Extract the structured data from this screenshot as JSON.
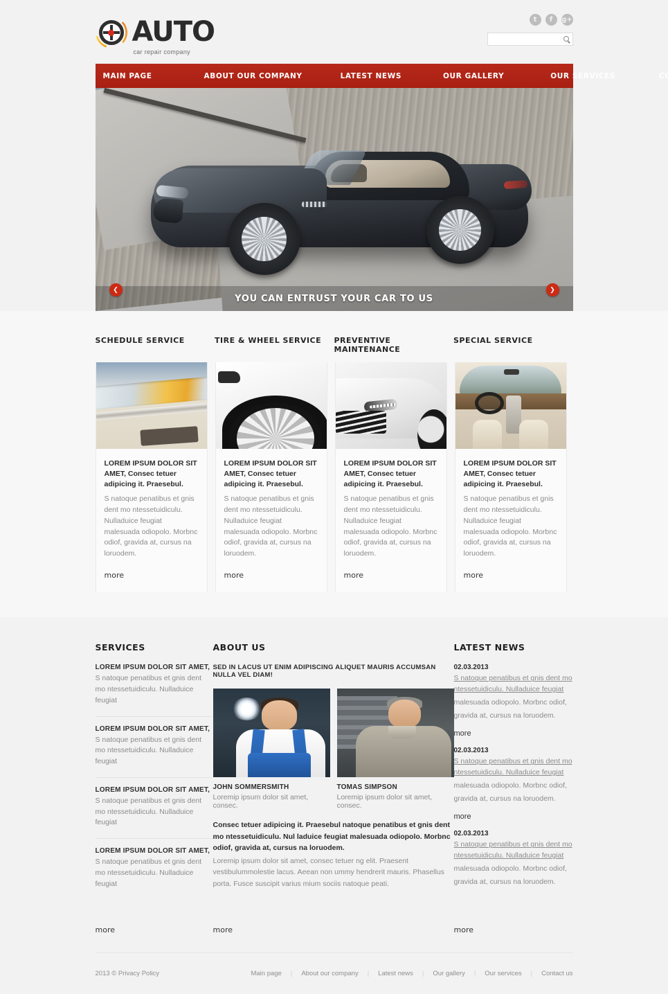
{
  "site": {
    "logo_title": "AUTO",
    "logo_sub": "car repair company",
    "logo_icon": "steering-wheel-icon"
  },
  "header": {
    "socials": [
      {
        "name": "twitter-icon",
        "glyph": "t"
      },
      {
        "name": "facebook-icon",
        "glyph": "f"
      },
      {
        "name": "googleplus-icon",
        "glyph": "g+"
      }
    ],
    "search": {
      "value": "",
      "placeholder": "",
      "icon": "search-icon"
    }
  },
  "nav": {
    "items": [
      "MAIN PAGE",
      "ABOUT OUR COMPANY",
      "LATEST NEWS",
      "OUR GALLERY",
      "OUR SERVICES",
      "CONTACT US"
    ]
  },
  "slider": {
    "caption": "YOU CAN ENTRUST YOUR CAR TO US",
    "prev_icon": "chevron-left-icon",
    "next_icon": "chevron-right-icon",
    "photo_alt": "dark-grey-convertible-on-dock"
  },
  "cards": {
    "headings": [
      "SCHEDULE SERVICE",
      "TIRE & WHEEL SERVICE",
      "PREVENTIVE MAINTENANCE",
      "SPECIAL SERVICE"
    ],
    "lead": "LOREM IPSUM DOLOR SIT AMET, Consec tetuer adipicing it. Praesebul.",
    "text": "S natoque penatibus et gnis dent mo ntessetuidiculu. Nulladuice feugiat malesuada odiopolo. Morbnc odiof, gravida at, cursus na loruodem.",
    "more_label": "more",
    "items": [
      {
        "photo_alt": "car-headlight-closeup"
      },
      {
        "photo_alt": "white-car-wheel"
      },
      {
        "photo_alt": "white-sports-car-front"
      },
      {
        "photo_alt": "beige-car-interior"
      }
    ]
  },
  "services": {
    "title": "SERVICES",
    "more_label": "more",
    "items": [
      {
        "head": "LOREM IPSUM DOLOR SIT AMET,",
        "text": "S natoque penatibus et gnis dent mo ntessetuidiculu. Nulladuice feugiat"
      },
      {
        "head": "LOREM IPSUM DOLOR SIT AMET,",
        "text": "S natoque penatibus et gnis dent mo ntessetuidiculu. Nulladuice feugiat"
      },
      {
        "head": "LOREM IPSUM DOLOR SIT AMET,",
        "text": "S natoque penatibus et gnis dent mo ntessetuidiculu. Nulladuice feugiat"
      },
      {
        "head": "LOREM IPSUM DOLOR SIT AMET,",
        "text": "S natoque penatibus et gnis dent mo ntessetuidiculu. Nulladuice feugiat"
      }
    ]
  },
  "about": {
    "title": "ABOUT US",
    "subtitle": "SED IN LACUS UT ENIM ADIPISCING ALIQUET MAURIS ACCUMSAN NULLA VEL DIAM!",
    "team": [
      {
        "name": "JOHN SOMMERSMITH",
        "role": "Loremip ipsum dolor sit amet, consec.",
        "photo_alt": "mechanic-in-blue-overalls"
      },
      {
        "name": "TOMAS SIMPSON",
        "role": "Loremip ipsum dolor sit amet, consec.",
        "photo_alt": "mechanic-in-grey-uniform"
      }
    ],
    "lead": "Consec tetuer adipicing it. Praesebul natoque penatibus et gnis dent mo ntessetuidiculu. Nul laduice feugiat  malesuada odiopolo. Morbnc odiof,  gravida at, cursus na loruodem.",
    "text": "Loremip ipsum dolor sit amet, consec tetuer ng elit. Praesent vestibulummolestie lacus. Aeean non ummy hendrerit mauris. Phasellus porta. Fusce suscipit varius mium sociis natoque peati.",
    "more_label": "more"
  },
  "news": {
    "title": "LATEST NEWS",
    "more_label": "more",
    "items": [
      {
        "date": "02.03.2013",
        "link": "S natoque penatibus et gnis dent mo ntessetuidiculu. Nulladuice feugiat",
        "text": "malesuada odiopolo. Morbnc odiof, gravida at, cursus na loruodem.",
        "more_label": "more"
      },
      {
        "date": "02.03.2013",
        "link": "S natoque penatibus et gnis dent mo ntessetuidiculu. Nulladuice feugiat",
        "text": "malesuada odiopolo. Morbnc odiof, gravida at, cursus na loruodem.",
        "more_label": "more"
      },
      {
        "date": "02.03.2013",
        "link": "S natoque penatibus et gnis dent mo ntessetuidiculu. Nulladuice feugiat",
        "text": "malesuada odiopolo. Morbnc odiof, gravida at, cursus na loruodem.",
        "more_label": "more"
      }
    ]
  },
  "footer": {
    "copyright": "2013 © Privacy Policy",
    "links": [
      "Main page",
      "About our company",
      "Latest news",
      "Our gallery",
      "Our services",
      "Contact us"
    ],
    "separator": "|"
  },
  "colors": {
    "accent_red": "#b32317",
    "slider_arrow_red": "#cc2a14",
    "page_bg": "#f2f2f2",
    "text_dark": "#2b2b2b",
    "text_muted": "#8b8b8b"
  }
}
